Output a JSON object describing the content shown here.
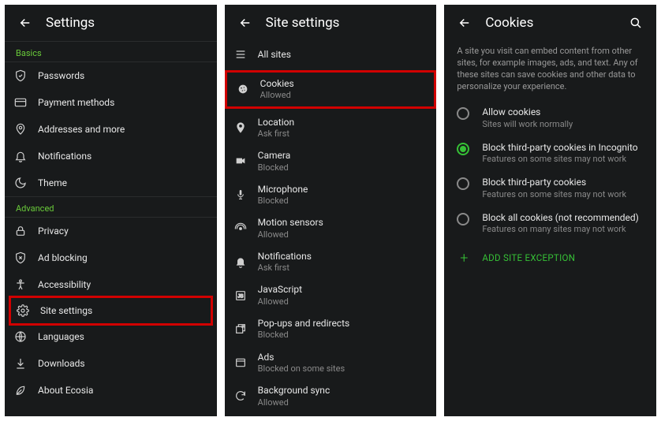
{
  "panel1": {
    "title": "Settings",
    "sections": {
      "basics": {
        "label": "Basics",
        "items": [
          {
            "label": "Passwords"
          },
          {
            "label": "Payment methods"
          },
          {
            "label": "Addresses and more"
          },
          {
            "label": "Notifications"
          },
          {
            "label": "Theme"
          }
        ]
      },
      "advanced": {
        "label": "Advanced",
        "items": [
          {
            "label": "Privacy"
          },
          {
            "label": "Ad blocking"
          },
          {
            "label": "Accessibility"
          },
          {
            "label": "Site settings"
          },
          {
            "label": "Languages"
          },
          {
            "label": "Downloads"
          },
          {
            "label": "About Ecosia"
          }
        ]
      }
    }
  },
  "panel2": {
    "title": "Site settings",
    "items": [
      {
        "label": "All sites",
        "sublabel": ""
      },
      {
        "label": "Cookies",
        "sublabel": "Allowed"
      },
      {
        "label": "Location",
        "sublabel": "Ask first"
      },
      {
        "label": "Camera",
        "sublabel": "Blocked"
      },
      {
        "label": "Microphone",
        "sublabel": "Blocked"
      },
      {
        "label": "Motion sensors",
        "sublabel": "Allowed"
      },
      {
        "label": "Notifications",
        "sublabel": "Ask first"
      },
      {
        "label": "JavaScript",
        "sublabel": "Allowed"
      },
      {
        "label": "Pop-ups and redirects",
        "sublabel": "Blocked"
      },
      {
        "label": "Ads",
        "sublabel": "Blocked on some sites"
      },
      {
        "label": "Background sync",
        "sublabel": "Allowed"
      }
    ]
  },
  "panel3": {
    "title": "Cookies",
    "description": "A site you visit can embed content from other sites, for example images, ads, and text. Any of these sites can save cookies and other data to personalize your experience.",
    "options": [
      {
        "label": "Allow cookies",
        "sublabel": "Sites will work normally",
        "selected": false
      },
      {
        "label": "Block third-party cookies in Incognito",
        "sublabel": "Features on some sites may not work",
        "selected": true
      },
      {
        "label": "Block third-party cookies",
        "sublabel": "Features on some sites may not work",
        "selected": false
      },
      {
        "label": "Block all cookies (not recommended)",
        "sublabel": "Features on many sites may not work",
        "selected": false
      }
    ],
    "add_exception_label": "ADD SITE EXCEPTION"
  }
}
